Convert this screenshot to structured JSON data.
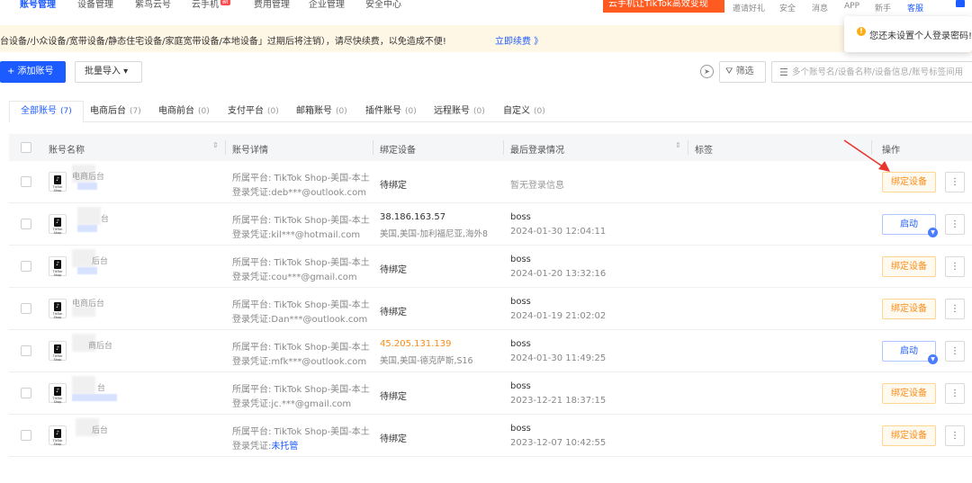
{
  "nav": {
    "tabs": [
      {
        "label": "账号管理",
        "active": true
      },
      {
        "label": "设备管理"
      },
      {
        "label": "紫鸟云号"
      },
      {
        "label": "云手机",
        "badge": "新"
      },
      {
        "label": "费用管理"
      },
      {
        "label": "企业管理"
      },
      {
        "label": "安全中心"
      }
    ],
    "promo": "云手机让TikTok高效变现",
    "links": [
      "邀请好礼",
      "安全",
      "消息",
      "APP",
      "新手",
      "客服"
    ]
  },
  "popup": {
    "text": "您还未设置个人登录密码!"
  },
  "notice": {
    "text": "台设备/小众设备/宽带设备/静态住宅设备/家庭宽带设备/本地设备」过期后将注销），请尽快续费，以免造成不便!",
    "link": "立即续费 》"
  },
  "toolbar": {
    "add_label": "+ 添加账号",
    "import_label": "批量导入 ▾",
    "filter_label": "筛选",
    "search_placeholder": "多个账号名/设备名称/设备信息/账号标签间用"
  },
  "tabs": [
    {
      "label": "全部账号",
      "count": "(7)",
      "active": true
    },
    {
      "label": "电商后台",
      "count": "(7)"
    },
    {
      "label": "电商前台",
      "count": "(0)"
    },
    {
      "label": "支付平台",
      "count": "(0)"
    },
    {
      "label": "邮箱账号",
      "count": "(0)"
    },
    {
      "label": "插件账号",
      "count": "(0)"
    },
    {
      "label": "远程账号",
      "count": "(0)"
    },
    {
      "label": "自定义",
      "count": "(0)"
    }
  ],
  "table": {
    "headers": {
      "name": "账号名称",
      "detail": "账号详情",
      "device": "绑定设备",
      "login": "最后登录情况",
      "tag": "标签",
      "action": "操作"
    },
    "logo_text": "TikTok Shop",
    "rows": [
      {
        "name": "电商后台",
        "platform": "所属平台: TikTok Shop-美国-本土",
        "cred_prefix": "登录凭证:",
        "cred": "deb***@outlook.com",
        "device_status": "待绑定",
        "login_none": "暂无登录信息",
        "action": "绑定设备"
      },
      {
        "name": "台",
        "platform": "所属平台: TikTok Shop-美国-本土",
        "cred_prefix": "登录凭证:",
        "cred": "kil***@hotmail.com",
        "ip": "38.186.163.57",
        "ip_location": "美国,美国-加利福尼亚,海外8",
        "login_user": "boss",
        "login_time": "2024-01-30 12:04:11",
        "action": "启动"
      },
      {
        "name": "后台",
        "platform": "所属平台: TikTok Shop-美国-本土",
        "cred_prefix": "登录凭证:",
        "cred": "cou***@gmail.com",
        "device_status": "待绑定",
        "login_user": "boss",
        "login_time": "2024-01-20 13:32:16",
        "action": "绑定设备"
      },
      {
        "name": "电商后台",
        "platform": "所属平台: TikTok Shop-美国-本土",
        "cred_prefix": "登录凭证:",
        "cred": "Dan***@outlook.com",
        "device_status": "待绑定",
        "login_user": "boss",
        "login_time": "2024-01-19 21:02:02",
        "action": "绑定设备"
      },
      {
        "name": "商后台",
        "platform": "所属平台: TikTok Shop-美国-本土",
        "cred_prefix": "登录凭证:",
        "cred": "mfk***@outlook.com",
        "ip": "45.205.131.139",
        "ip_location": "美国,美国-德克萨斯,S16",
        "ip_highlight": true,
        "login_user": "boss",
        "login_time": "2024-01-30 11:49:25",
        "action": "启动"
      },
      {
        "name": "台",
        "platform": "所属平台: TikTok Shop-美国-本土",
        "cred_prefix": "登录凭证:",
        "cred": "jc.***@gmail.com",
        "device_status": "待绑定",
        "login_user": "boss",
        "login_time": "2023-12-21 18:37:15",
        "action": "绑定设备"
      },
      {
        "name": "后台",
        "platform": "所属平台: TikTok Shop-美国-本土",
        "cred_prefix": "登录凭证:",
        "cred": "未托管",
        "cred_link": true,
        "device_status": "待绑定",
        "login_user": "boss",
        "login_time": "2023-12-07 10:42:55",
        "action": "绑定设备"
      }
    ],
    "more_label": "⋮"
  },
  "colors": {
    "accent": "#1b5bff",
    "promo": "#ff5a1f",
    "warning": "#fa8c16",
    "notice_bg": "#fff7e6",
    "arrow": "#e8352d"
  }
}
